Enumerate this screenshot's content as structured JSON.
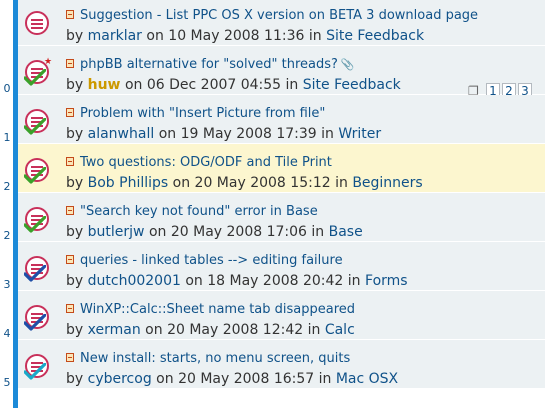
{
  "colors": {
    "stripe": "#1c8ad8",
    "row_bg": "#ecf1f3",
    "row_highlight": "#fcf6cf",
    "link": "#105289",
    "icon_red": "#c8305a",
    "tick_green": "#3aa12a",
    "tick_blue": "#1f4fa8",
    "tick_cyan": "#1aa9c9"
  },
  "topics": [
    {
      "reply_count": "",
      "title": "Suggestion - List PPC OS X version on BETA 3 download page",
      "by": "by",
      "author": "marklar",
      "on": "on",
      "date": "10 May 2008 11:36",
      "in": "in",
      "forum": "Site Feedback",
      "icon": "topic-icon",
      "tick": "none",
      "highlighted": false,
      "pages": []
    },
    {
      "reply_count": "0",
      "title": "phpBB alternative for \"solved\" threads?",
      "attachment": "paperclip-icon",
      "by": "by",
      "author": "huw",
      "author_style": "gold",
      "on": "on",
      "date": "06 Dec 2007 04:55",
      "in": "in",
      "forum": "Site Feedback",
      "icon": "topic-icon",
      "tick": "green",
      "star": true,
      "highlighted": false,
      "pages": [
        "1",
        "2",
        "3"
      ]
    },
    {
      "reply_count": "1",
      "title": "Problem with \"Insert Picture from file\"",
      "by": "by",
      "author": "alanwhall",
      "on": "on",
      "date": "19 May 2008 17:39",
      "in": "in",
      "forum": "Writer",
      "icon": "topic-icon",
      "tick": "green",
      "highlighted": false,
      "pages": []
    },
    {
      "reply_count": "2",
      "title": "Two questions: ODG/ODF and Tile Print",
      "by": "by",
      "author": "Bob Phillips",
      "on": "on",
      "date": "20 May 2008 15:12",
      "in": "in",
      "forum": "Beginners",
      "icon": "topic-icon",
      "tick": "green",
      "highlighted": true,
      "pages": []
    },
    {
      "reply_count": "2",
      "title": "\"Search key not found\" error in Base",
      "by": "by",
      "author": "butlerjw",
      "on": "on",
      "date": "20 May 2008 17:06",
      "in": "in",
      "forum": "Base",
      "icon": "topic-icon",
      "tick": "green",
      "highlighted": false,
      "pages": []
    },
    {
      "reply_count": "3",
      "title": "queries - linked tables --> editing failure",
      "by": "by",
      "author": "dutch002001",
      "on": "on",
      "date": "18 May 2008 20:42",
      "in": "in",
      "forum": "Forms",
      "icon": "topic-icon",
      "tick": "blue",
      "highlighted": false,
      "pages": []
    },
    {
      "reply_count": "4",
      "title": "WinXP::Calc::Sheet name tab disappeared",
      "by": "by",
      "author": "xerman",
      "on": "on",
      "date": "20 May 2008 12:42",
      "in": "in",
      "forum": "Calc",
      "icon": "topic-icon",
      "tick": "blue",
      "highlighted": false,
      "pages": []
    },
    {
      "reply_count": "5",
      "title": "New install: starts, no menu screen, quits",
      "by": "by",
      "author": "cybercog",
      "on": "on",
      "date": "20 May 2008 16:57",
      "in": "in",
      "forum": "Mac OSX",
      "icon": "topic-icon",
      "tick": "cyan",
      "highlighted": false,
      "pages": []
    }
  ]
}
